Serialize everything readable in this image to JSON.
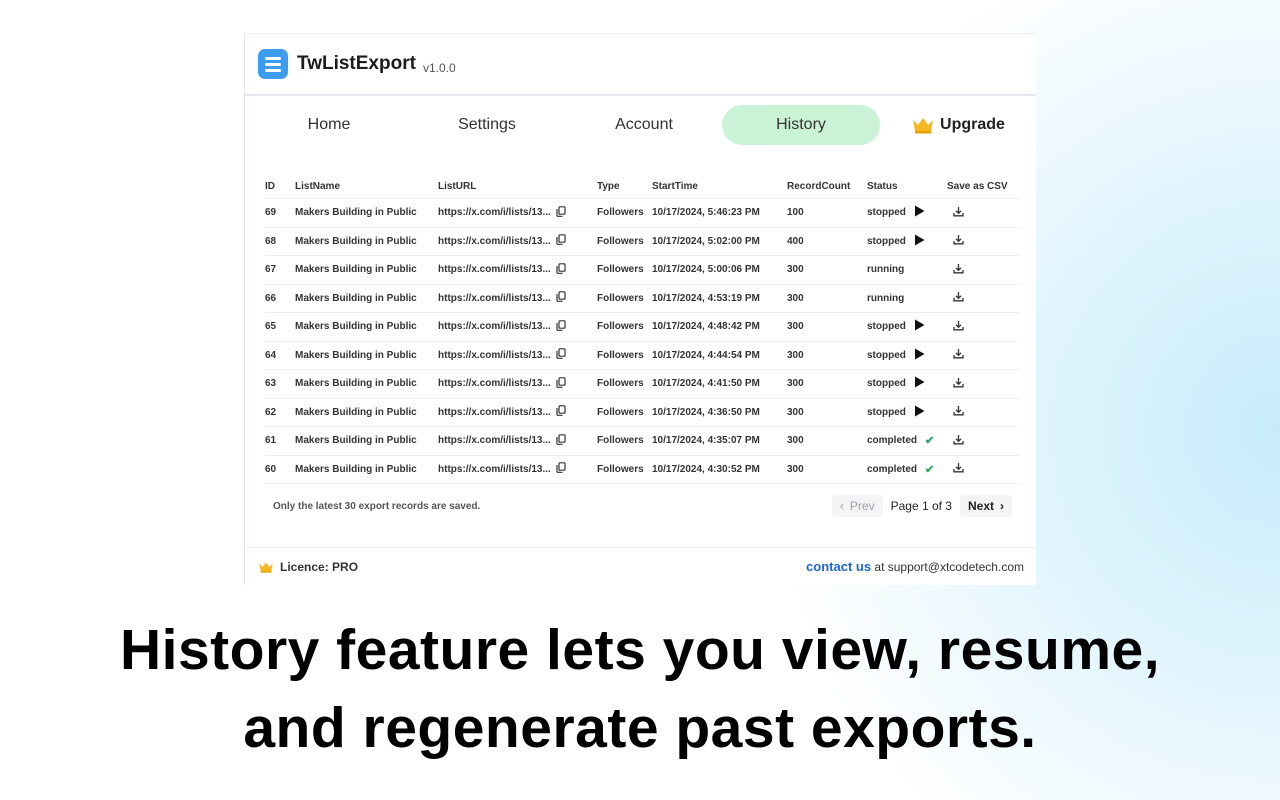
{
  "app": {
    "name": "TwListExport",
    "version": "v1.0.0"
  },
  "tabs": [
    {
      "label": "Home",
      "active": false
    },
    {
      "label": "Settings",
      "active": false
    },
    {
      "label": "Account",
      "active": false
    },
    {
      "label": "History",
      "active": true
    },
    {
      "label": "Upgrade",
      "active": false,
      "icon": "crown-icon"
    }
  ],
  "table": {
    "columns": [
      "ID",
      "ListName",
      "ListURL",
      "Type",
      "StartTime",
      "RecordCount",
      "Status",
      "Save as CSV"
    ],
    "rows": [
      {
        "id": "69",
        "name": "Makers Building in Public",
        "url": "https://x.com/i/lists/13...",
        "type": "Followers",
        "start": "10/17/2024, 5:46:23 PM",
        "count": "100",
        "status": "stopped"
      },
      {
        "id": "68",
        "name": "Makers Building in Public",
        "url": "https://x.com/i/lists/13...",
        "type": "Followers",
        "start": "10/17/2024, 5:02:00 PM",
        "count": "400",
        "status": "stopped"
      },
      {
        "id": "67",
        "name": "Makers Building in Public",
        "url": "https://x.com/i/lists/13...",
        "type": "Followers",
        "start": "10/17/2024, 5:00:06 PM",
        "count": "300",
        "status": "running"
      },
      {
        "id": "66",
        "name": "Makers Building in Public",
        "url": "https://x.com/i/lists/13...",
        "type": "Followers",
        "start": "10/17/2024, 4:53:19 PM",
        "count": "300",
        "status": "running"
      },
      {
        "id": "65",
        "name": "Makers Building in Public",
        "url": "https://x.com/i/lists/13...",
        "type": "Followers",
        "start": "10/17/2024, 4:48:42 PM",
        "count": "300",
        "status": "stopped"
      },
      {
        "id": "64",
        "name": "Makers Building in Public",
        "url": "https://x.com/i/lists/13...",
        "type": "Followers",
        "start": "10/17/2024, 4:44:54 PM",
        "count": "300",
        "status": "stopped"
      },
      {
        "id": "63",
        "name": "Makers Building in Public",
        "url": "https://x.com/i/lists/13...",
        "type": "Followers",
        "start": "10/17/2024, 4:41:50 PM",
        "count": "300",
        "status": "stopped"
      },
      {
        "id": "62",
        "name": "Makers Building in Public",
        "url": "https://x.com/i/lists/13...",
        "type": "Followers",
        "start": "10/17/2024, 4:36:50 PM",
        "count": "300",
        "status": "stopped"
      },
      {
        "id": "61",
        "name": "Makers Building in Public",
        "url": "https://x.com/i/lists/13...",
        "type": "Followers",
        "start": "10/17/2024, 4:35:07 PM",
        "count": "300",
        "status": "completed"
      },
      {
        "id": "60",
        "name": "Makers Building in Public",
        "url": "https://x.com/i/lists/13...",
        "type": "Followers",
        "start": "10/17/2024, 4:30:52 PM",
        "count": "300",
        "status": "completed"
      }
    ]
  },
  "note": "Only the latest 30 export records are saved.",
  "pagination": {
    "prev": "Prev",
    "info": "Page 1 of 3",
    "next": "Next"
  },
  "footer": {
    "licence": "Licence: PRO",
    "contact_link": "contact us",
    "contact_rest": " at support@xtcodetech.com"
  },
  "caption": {
    "line1": "History feature lets you view, resume,",
    "line2": "and regenerate past exports."
  },
  "colors": {
    "active_tab": "#c9f2d6",
    "logo": "#3b9cf0",
    "link": "#1b66d6",
    "completed": "#26a65b",
    "crown": "#f5b820"
  }
}
